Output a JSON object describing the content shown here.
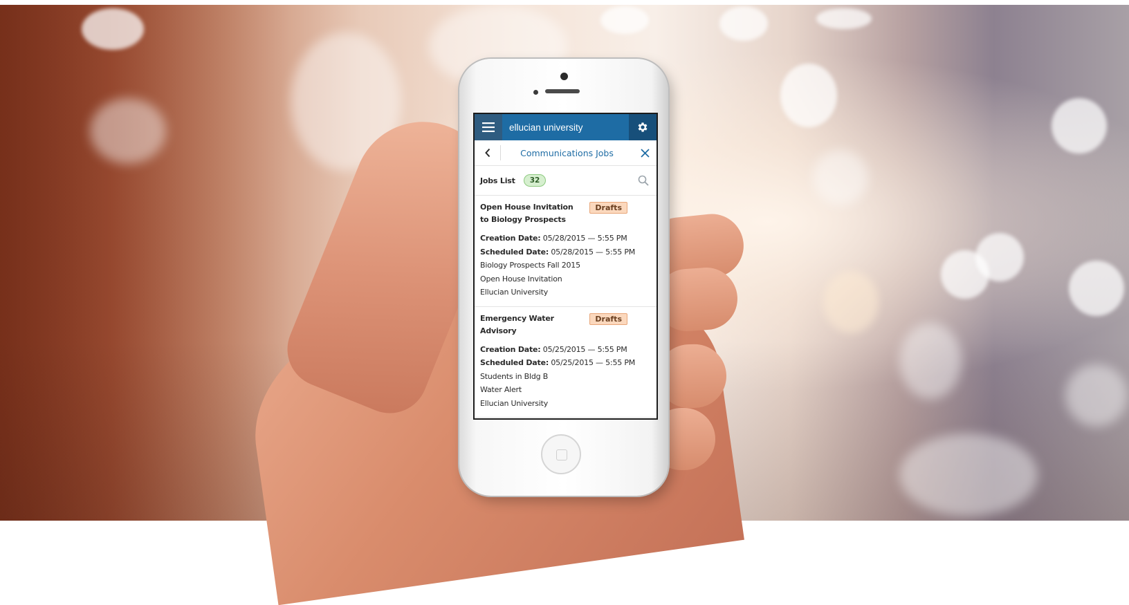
{
  "app": {
    "title": "ellucian university"
  },
  "nav": {
    "title": "Communications Jobs"
  },
  "list": {
    "label": "Jobs List",
    "count": "32"
  },
  "jobs": [
    {
      "title": "Open House Invitation to Biology Prospects",
      "status": "Drafts",
      "creation_label": "Creation Date:",
      "creation_value": " 05/28/2015 — 5:55 PM",
      "scheduled_label": "Scheduled Date:",
      "scheduled_value": " 05/28/2015 — 5:55 PM",
      "population": "Biology Prospects Fall 2015",
      "template": "Open House Invitation",
      "organization": "Ellucian University"
    },
    {
      "title": "Emergency Water Advisory",
      "status": "Drafts",
      "creation_label": "Creation Date:",
      "creation_value": " 05/25/2015 — 5:55 PM",
      "scheduled_label": "Scheduled Date:",
      "scheduled_value": " 05/25/2015 — 5:55 PM",
      "population": "Students in Bldg B",
      "template": "Water Alert",
      "organization": "Ellucian University"
    }
  ],
  "icons": {
    "menu": "hamburger-menu-icon",
    "settings": "gear-icon",
    "back": "chevron-left-icon",
    "close": "close-icon",
    "search": "search-icon"
  },
  "colors": {
    "header_blue": "#1e6ca4",
    "menu_button": "#2f5c80",
    "badge_green": "#d6efcf",
    "draft_orange": "#fbd8bd"
  }
}
